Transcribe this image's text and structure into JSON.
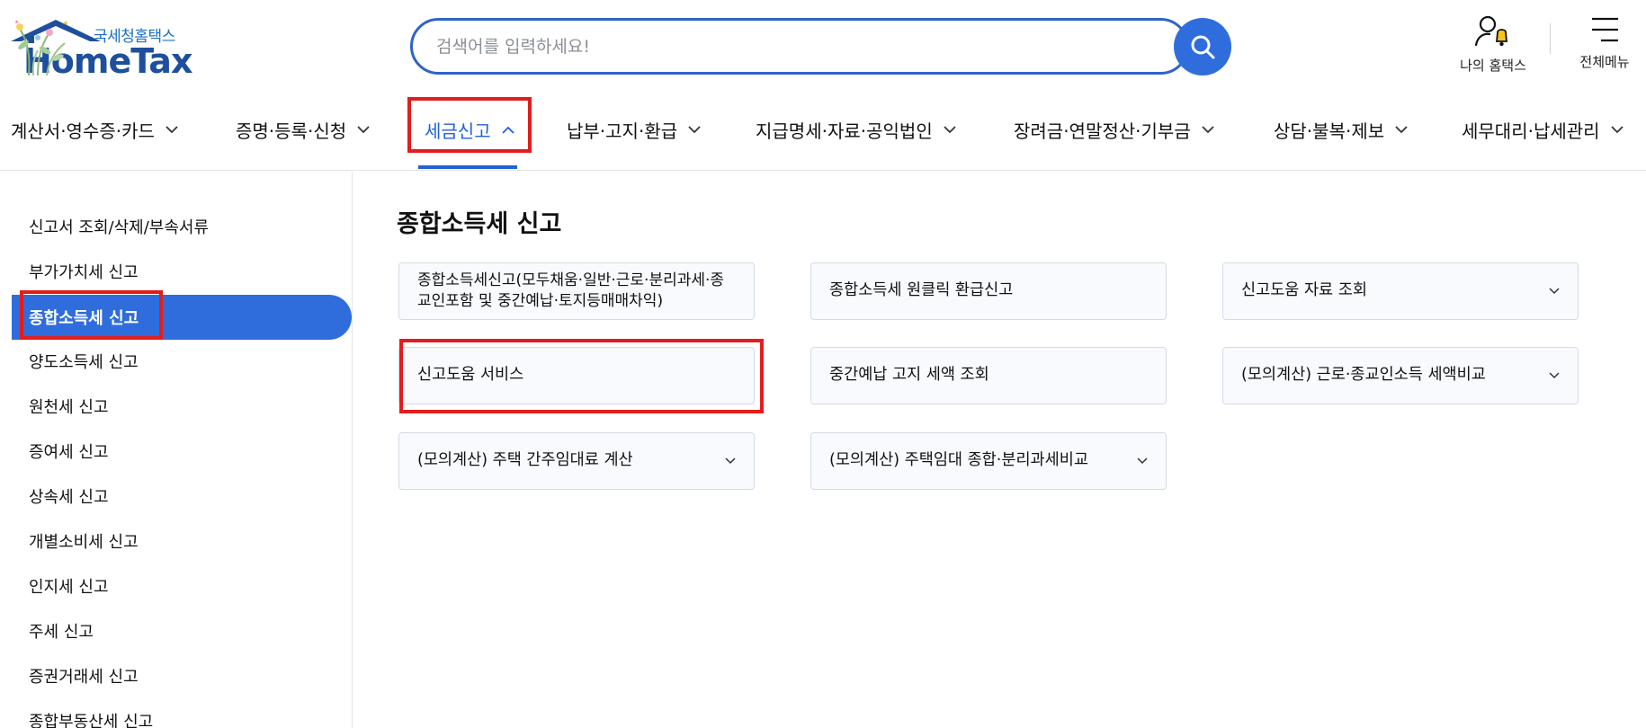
{
  "header": {
    "logo_sub": "국세청홈택스",
    "logo_main": "HomeTax",
    "search_placeholder": "검색어를 입력하세요!",
    "my_hometax_label": "나의 홈택스",
    "all_menu_label": "전체메뉴"
  },
  "gnb": {
    "items": [
      {
        "label": "계산서·영수증·카드"
      },
      {
        "label": "증명·등록·신청"
      },
      {
        "label": "세금신고"
      },
      {
        "label": "납부·고지·환급"
      },
      {
        "label": "지급명세·자료·공익법인"
      },
      {
        "label": "장려금·연말정산·기부금"
      },
      {
        "label": "상담·불복·제보"
      },
      {
        "label": "세무대리·납세관리"
      }
    ],
    "active_index": 2
  },
  "sidebar": {
    "items": [
      {
        "label": "신고서 조회/삭제/부속서류"
      },
      {
        "label": "부가가치세 신고"
      },
      {
        "label": "종합소득세 신고"
      },
      {
        "label": "양도소득세 신고"
      },
      {
        "label": "원천세 신고"
      },
      {
        "label": "증여세 신고"
      },
      {
        "label": "상속세 신고"
      },
      {
        "label": "개별소비세 신고"
      },
      {
        "label": "인지세 신고"
      },
      {
        "label": "주세 신고"
      },
      {
        "label": "증권거래세 신고"
      },
      {
        "label": "종합부동산세 신고"
      }
    ],
    "active_index": 2
  },
  "main": {
    "title": "종합소득세 신고",
    "cards": [
      {
        "label": "종합소득세신고(모두채움·일반·근로·분리과세·종교인포함 및 중간예납·토지등매매차익)",
        "expandable": false
      },
      {
        "label": "종합소득세 원클릭 환급신고",
        "expandable": false
      },
      {
        "label": "신고도움 자료 조회",
        "expandable": true
      },
      {
        "label": "신고도움 서비스",
        "expandable": false
      },
      {
        "label": "중간예납 고지 세액 조회",
        "expandable": false
      },
      {
        "label": "(모의계산) 근로·종교인소득 세액비교",
        "expandable": true
      },
      {
        "label": "(모의계산) 주택 간주임대료 계산",
        "expandable": true
      },
      {
        "label": "(모의계산) 주택임대 종합·분리과세비교",
        "expandable": true
      }
    ]
  },
  "colors": {
    "accent": "#2f6ddd",
    "active_nav": "#2261d6",
    "highlight_box": "#e31d1d",
    "card_bg": "#f8fafd",
    "card_border": "#d3dbe6"
  }
}
